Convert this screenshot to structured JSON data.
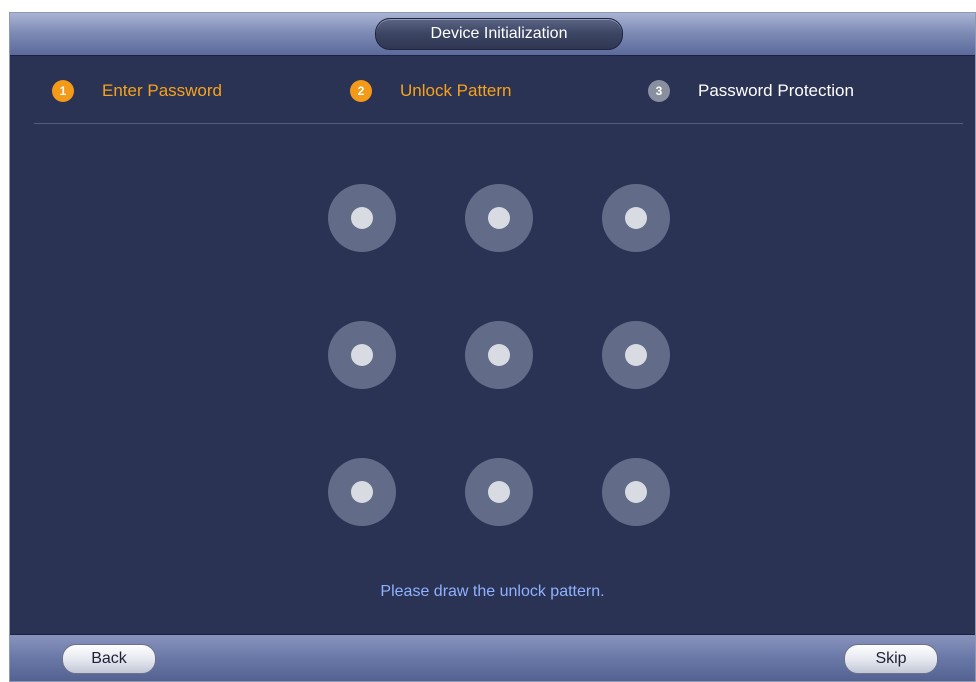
{
  "window": {
    "title": "Device Initialization"
  },
  "steps": [
    {
      "number": "1",
      "label": "Enter Password",
      "state": "completed"
    },
    {
      "number": "2",
      "label": "Unlock Pattern",
      "state": "current"
    },
    {
      "number": "3",
      "label": "Password Protection",
      "state": "pending"
    }
  ],
  "pattern": {
    "rows": 3,
    "cols": 3,
    "hint": "Please draw the unlock pattern."
  },
  "footer": {
    "back_label": "Back",
    "skip_label": "Skip"
  },
  "colors": {
    "panel_bg": "#2b3354",
    "accent_orange": "#f39a18",
    "hint_blue": "#8fb1ff",
    "inactive_step": "#8a8fa0"
  }
}
